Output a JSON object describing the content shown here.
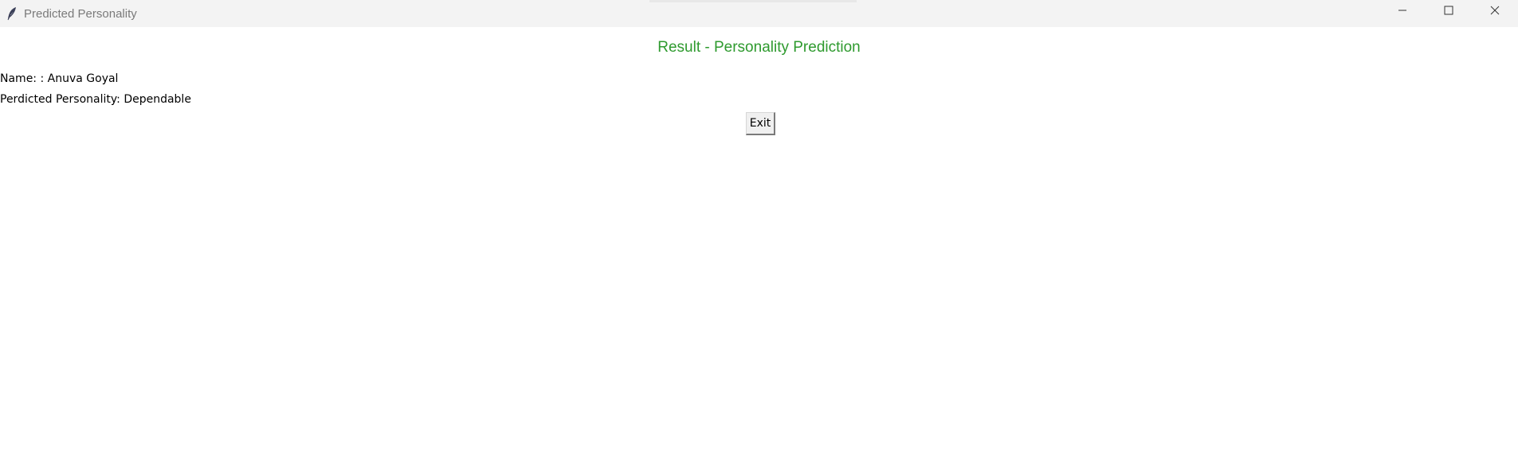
{
  "window": {
    "title": "Predicted Personality",
    "icon": "feather-icon",
    "controls": [
      "minimize-icon",
      "maximize-icon",
      "close-icon"
    ]
  },
  "main": {
    "heading": "Result - Personality Prediction",
    "heading_color": "#2e9a2e",
    "name_label": "Name: : ",
    "name_value": "Anuva Goyal",
    "personality_label": "Perdicted Personality: ",
    "personality_value": "Dependable",
    "exit_label": "Exit"
  }
}
